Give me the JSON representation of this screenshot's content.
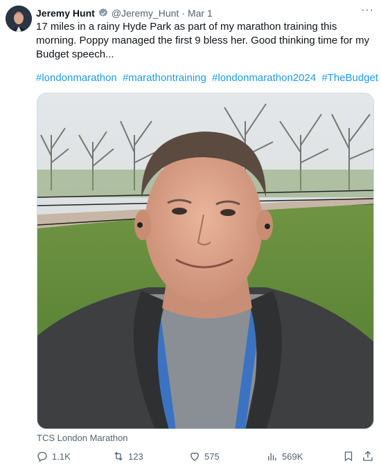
{
  "author": {
    "name": "Jeremy Hunt",
    "handle": "@Jeremy_Hunt",
    "separator": "·",
    "date": "Mar 1"
  },
  "more_label": "···",
  "tweet": {
    "text": "17 miles in a rainy Hyde Park as part of my marathon training this morning. Poppy managed the first 9 bless her. Good thinking time for my Budget speech...",
    "hashtags": [
      "#londonmarathon",
      "#marathontraining",
      "#londonmarathon2024",
      "#TheBudget"
    ]
  },
  "media": {
    "caption": "TCS London Marathon"
  },
  "actions": {
    "replies": "1.1K",
    "reposts": "123",
    "likes": "575",
    "views": "569K"
  },
  "colors": {
    "accent": "#1d9bf0",
    "muted": "#536471",
    "text": "#0f1419"
  }
}
